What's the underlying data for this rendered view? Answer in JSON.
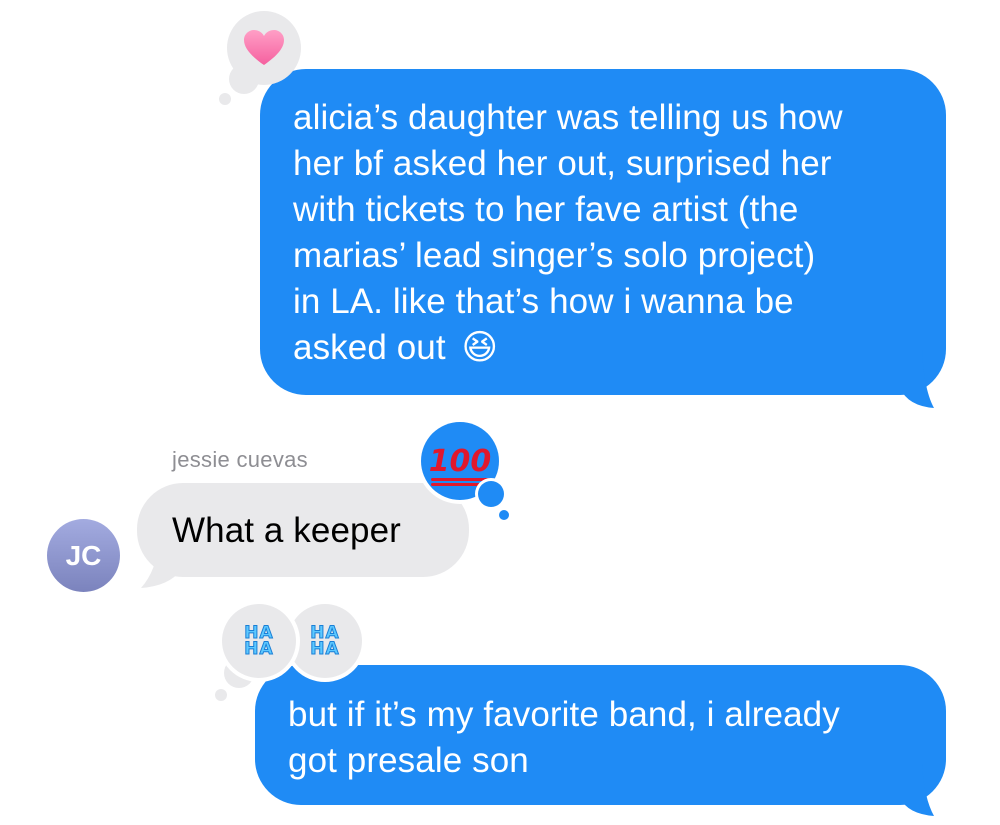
{
  "thread": {
    "message1": {
      "direction": "outgoing",
      "lines": [
        "alicia’s daughter was telling us how",
        "her bf asked her out, surprised her",
        "with tickets to her fave artist (the",
        "marias’ lead singer’s solo project)",
        "in LA. like that’s how i wanna be",
        "asked out"
      ],
      "emoji": "😆",
      "tapback_icon": "heart-icon"
    },
    "message2": {
      "direction": "incoming",
      "sender": "jessie cuevas",
      "avatar_initials": "JC",
      "text": "What a keeper",
      "tapback": "100",
      "tapback_icon": "hundred-points-icon"
    },
    "message3": {
      "direction": "outgoing",
      "lines": [
        "but if it’s my favorite band, i already",
        "got presale son"
      ],
      "tapback_label": "HA HA",
      "tapback_count": 2,
      "tapback_icon": "haha-icon"
    }
  },
  "colors": {
    "outgoing_bubble": "#1f8bf5",
    "incoming_bubble": "#e9e9eb",
    "tapback_bg": "#e9e9eb",
    "tapback_on_incoming_bg": "#1f8bf5",
    "avatar_gradient_top": "#a3abe0",
    "avatar_gradient_bottom": "#7b83bd",
    "sender_text": "#8e8e93"
  }
}
